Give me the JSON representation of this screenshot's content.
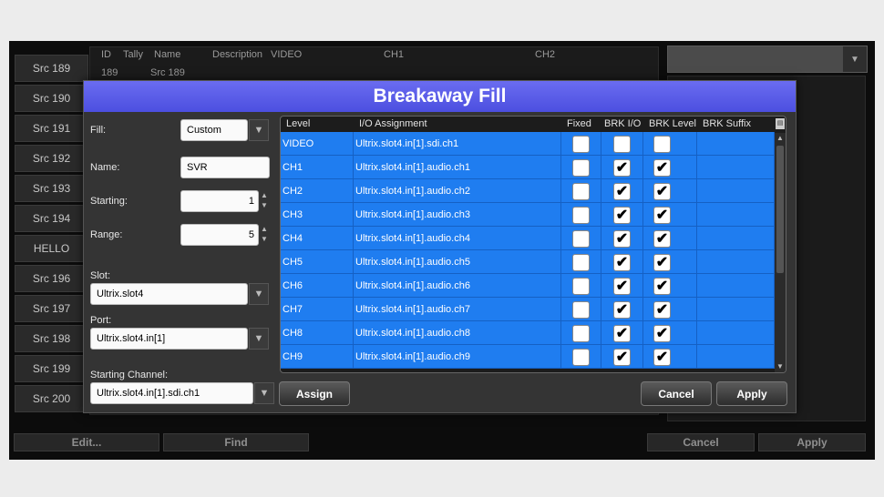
{
  "background": {
    "src_buttons": [
      "Src 189",
      "Src 190",
      "Src 191",
      "Src 192",
      "Src 193",
      "Src 194",
      "HELLO",
      "Src 196",
      "Src 197",
      "Src 198",
      "Src 199",
      "Src 200"
    ],
    "grid_headers": [
      "ID",
      "Tally",
      "Name",
      "Description",
      "VIDEO",
      "CH1",
      "CH2"
    ],
    "first_row": {
      "id": "189",
      "name": "Src 189"
    },
    "bottom_buttons": {
      "edit": "Edit...",
      "find": "Find",
      "cancel": "Cancel",
      "apply": "Apply"
    }
  },
  "dialog": {
    "title": "Breakaway Fill",
    "fill": {
      "label": "Fill:",
      "value": "Custom"
    },
    "name": {
      "label": "Name:",
      "value": "SVR"
    },
    "starting": {
      "label": "Starting:",
      "value": "1"
    },
    "range": {
      "label": "Range:",
      "value": "5"
    },
    "slot": {
      "label": "Slot:",
      "value": "Ultrix.slot4"
    },
    "port": {
      "label": "Port:",
      "value": "Ultrix.slot4.in[1]"
    },
    "starting_channel": {
      "label": "Starting Channel:",
      "value": "Ultrix.slot4.in[1].sdi.ch1"
    },
    "table": {
      "headers": {
        "level": "Level",
        "io": "I/O Assignment",
        "fixed": "Fixed",
        "brk_io": "BRK I/O",
        "brk_level": "BRK Level",
        "brk_suffix": "BRK Suffix"
      },
      "rows": [
        {
          "level": "VIDEO",
          "io": "Ultrix.slot4.in[1].sdi.ch1",
          "fixed": false,
          "brk_io": false,
          "brk_level": false
        },
        {
          "level": "CH1",
          "io": "Ultrix.slot4.in[1].audio.ch1",
          "fixed": false,
          "brk_io": true,
          "brk_level": true
        },
        {
          "level": "CH2",
          "io": "Ultrix.slot4.in[1].audio.ch2",
          "fixed": false,
          "brk_io": true,
          "brk_level": true
        },
        {
          "level": "CH3",
          "io": "Ultrix.slot4.in[1].audio.ch3",
          "fixed": false,
          "brk_io": true,
          "brk_level": true
        },
        {
          "level": "CH4",
          "io": "Ultrix.slot4.in[1].audio.ch4",
          "fixed": false,
          "brk_io": true,
          "brk_level": true
        },
        {
          "level": "CH5",
          "io": "Ultrix.slot4.in[1].audio.ch5",
          "fixed": false,
          "brk_io": true,
          "brk_level": true
        },
        {
          "level": "CH6",
          "io": "Ultrix.slot4.in[1].audio.ch6",
          "fixed": false,
          "brk_io": true,
          "brk_level": true
        },
        {
          "level": "CH7",
          "io": "Ultrix.slot4.in[1].audio.ch7",
          "fixed": false,
          "brk_io": true,
          "brk_level": true
        },
        {
          "level": "CH8",
          "io": "Ultrix.slot4.in[1].audio.ch8",
          "fixed": false,
          "brk_io": true,
          "brk_level": true
        },
        {
          "level": "CH9",
          "io": "Ultrix.slot4.in[1].audio.ch9",
          "fixed": false,
          "brk_io": true,
          "brk_level": true
        }
      ]
    },
    "buttons": {
      "assign": "Assign",
      "cancel": "Cancel",
      "apply": "Apply"
    }
  },
  "colors": {
    "title_bar": "#5a5de8",
    "row_blue": "#1f7df0",
    "dialog_bg": "#343434"
  }
}
